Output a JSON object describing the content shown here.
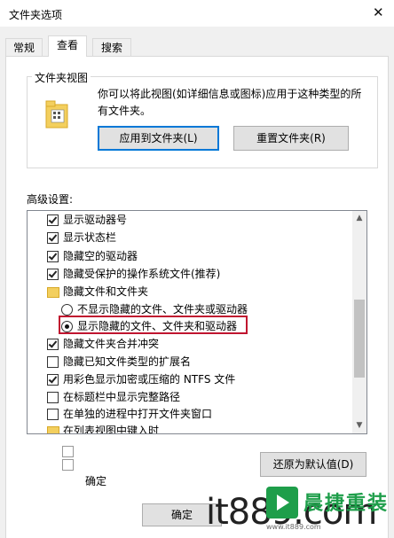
{
  "window": {
    "title": "文件夹选项",
    "close_glyph": "✕"
  },
  "tabs": [
    {
      "label": "常规",
      "active": false
    },
    {
      "label": "查看",
      "active": true
    },
    {
      "label": "搜索",
      "active": false
    }
  ],
  "folder_views": {
    "group_title": "文件夹视图",
    "description": "你可以将此视图(如详细信息或图标)应用于这种类型的所有文件夹。",
    "icon": "folder-icon",
    "apply_button": "应用到文件夹(L)",
    "reset_button": "重置文件夹(R)"
  },
  "advanced": {
    "label": "高级设置:",
    "items": [
      {
        "type": "checkbox",
        "checked": true,
        "label": "显示驱动器号"
      },
      {
        "type": "checkbox",
        "checked": true,
        "label": "显示状态栏"
      },
      {
        "type": "checkbox",
        "checked": true,
        "label": "隐藏空的驱动器"
      },
      {
        "type": "checkbox",
        "checked": true,
        "label": "隐藏受保护的操作系统文件(推荐)"
      },
      {
        "type": "folder",
        "label": "隐藏文件和文件夹"
      },
      {
        "type": "radio",
        "checked": false,
        "label": "不显示隐藏的文件、文件夹或驱动器"
      },
      {
        "type": "radio",
        "checked": true,
        "label": "显示隐藏的文件、文件夹和驱动器"
      },
      {
        "type": "checkbox",
        "checked": true,
        "label": "隐藏文件夹合并冲突"
      },
      {
        "type": "checkbox",
        "checked": false,
        "label": "隐藏已知文件类型的扩展名"
      },
      {
        "type": "checkbox",
        "checked": true,
        "label": "用彩色显示加密或压缩的 NTFS 文件"
      },
      {
        "type": "checkbox",
        "checked": false,
        "label": "在标题栏中显示完整路径"
      },
      {
        "type": "checkbox",
        "checked": false,
        "label": "在单独的进程中打开文件夹窗口"
      },
      {
        "type": "folder",
        "label": "在列表视图中键入时"
      }
    ],
    "restore_button": "还原为默认值(D)"
  },
  "footer": {
    "confirm_label": "确定",
    "ok_button": "确定"
  },
  "watermark": {
    "brand_cn": "晨捷重装",
    "url": "it889.com",
    "small": "www.it889.com"
  },
  "colors": {
    "highlight_border": "#c0152f",
    "accent": "#0078d7",
    "folder": "#f3cf5e",
    "watermark": "#1e9e4a"
  }
}
